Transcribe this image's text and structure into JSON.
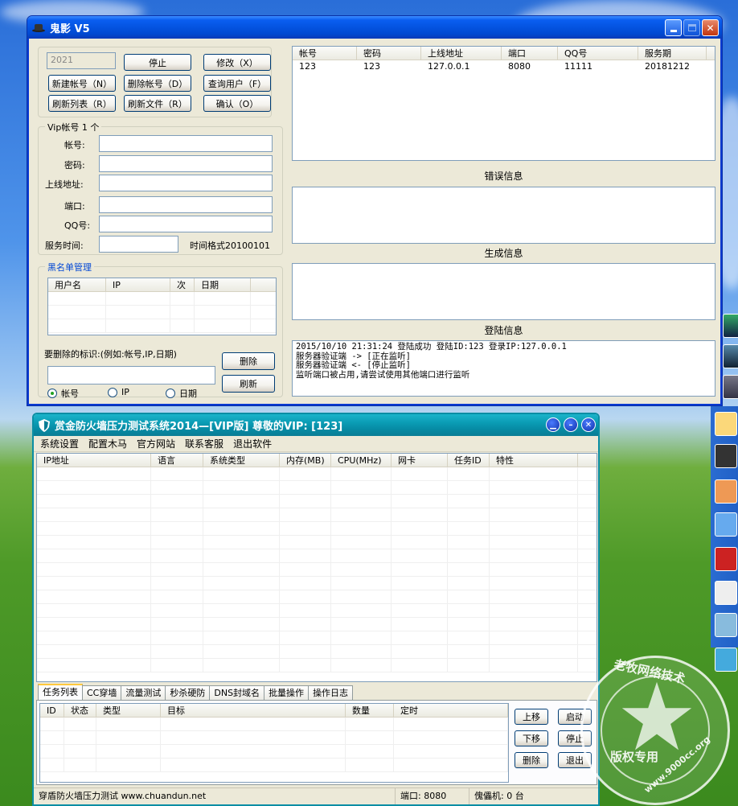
{
  "window1": {
    "title": "鬼影 V5",
    "year_field": "2021",
    "buttons": {
      "stop": "停止",
      "modify": "修改（X）",
      "new_account": "新建帐号（N）",
      "delete_account": "删除帐号（D）",
      "query_user": "查询用户（F）",
      "refresh_list": "刷新列表（R）",
      "refresh_file": "刷新文件（R）",
      "confirm": "确认（O）",
      "delete": "删除",
      "refresh": "刷新"
    },
    "vip_group": {
      "label": "Vip帐号 1 个",
      "account_label": "帐号:",
      "password_label": "密码:",
      "online_addr_label": "上线地址:",
      "port_label": "端口:",
      "qq_label": "QQ号:",
      "service_time_label": "服务时间:",
      "time_format_hint": "时间格式20100101"
    },
    "blacklist": {
      "label": "黑名单管理",
      "columns": [
        "用户名",
        "IP",
        "次",
        "日期"
      ],
      "delete_hint": "要删除的标识:(例如:帐号,IP,日期)",
      "radio_account": "帐号",
      "radio_ip": "IP",
      "radio_date": "日期"
    },
    "account_table": {
      "columns": [
        "帐号",
        "密码",
        "上线地址",
        "端口",
        "QQ号",
        "服务期"
      ],
      "rows": [
        [
          "123",
          "123",
          "127.0.0.1",
          "8080",
          "11111",
          "20181212"
        ]
      ]
    },
    "error_info_title": "错误信息",
    "generate_info_title": "生成信息",
    "login_info_title": "登陆信息",
    "login_log": [
      "2015/10/10 21:31:24 登陆成功 登陆ID:123 登录IP:127.0.0.1",
      "服务器验证端 -> [正在监听]",
      "服务器验证端 <- [停止监听]",
      "监听端口被占用,请尝试使用其他端口进行监听"
    ]
  },
  "window2": {
    "title": "赏金防火墙压力测试系统2014—[VIP版]   尊敬的VIP: [123]",
    "menu": [
      "系统设置",
      "配置木马",
      "官方网站",
      "联系客服",
      "退出软件"
    ],
    "host_columns": [
      "IP地址",
      "语言",
      "系统类型",
      "内存(MB)",
      "CPU(MHz)",
      "网卡",
      "任务ID",
      "特性"
    ],
    "tabs": [
      "任务列表",
      "CC穿墙",
      "流量测试",
      "秒杀硬防",
      "DNS封域名",
      "批量操作",
      "操作日志"
    ],
    "task_columns": [
      "ID",
      "状态",
      "类型",
      "目标",
      "数量",
      "定时"
    ],
    "buttons": {
      "move_up": "上移",
      "start": "启动",
      "move_down": "下移",
      "stop": "停止",
      "delete": "删除",
      "exit": "退出"
    },
    "status": {
      "site": "穿盾防火墙压力测试 www.chuandun.net",
      "port": "端口: 8080",
      "bots": "傀儡机: 0 台"
    }
  },
  "watermark": {
    "top_text": "老牧网络技术",
    "bottom_text": "版权专用",
    "site_text": "www.9000cc.org"
  },
  "colors": {
    "xp_blue_titlebar": "#0453e0",
    "teal_titlebar": "#0a9bb4",
    "window_face": "#ece9d8",
    "group_label_blue": "#0046d5"
  }
}
